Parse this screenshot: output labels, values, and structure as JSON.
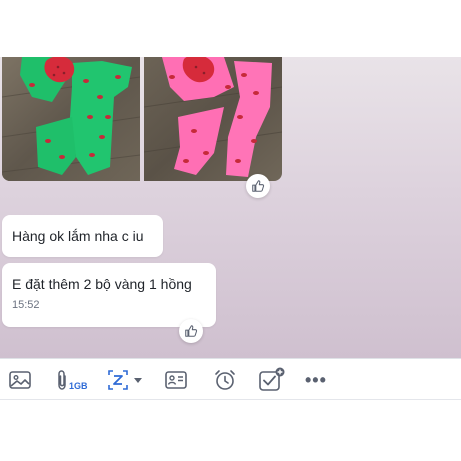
{
  "chat": {
    "messages": [
      {
        "text": "Hàng ok lắm nha c iu"
      },
      {
        "text": "E đặt thêm 2 bộ vàng 1 hồng",
        "time": "15:52"
      }
    ]
  },
  "toolbar": {
    "attach_size_badge": "1GB",
    "more_label": "•••",
    "icons": [
      "image-icon",
      "paperclip-icon",
      "screenshot-crop-icon",
      "chevron-down-icon",
      "contact-card-icon",
      "alarm-clock-icon",
      "task-checkbox-icon",
      "more-icon"
    ]
  },
  "colors": {
    "accent": "#2f6bd6",
    "icon_gray": "#5a6170",
    "bubble_bg": "#ffffff",
    "chat_bg": "#ddd2dd",
    "outfit_green": "#1fbf6a",
    "outfit_pink": "#ff6fb4",
    "strawberry_red": "#d62b3b"
  }
}
